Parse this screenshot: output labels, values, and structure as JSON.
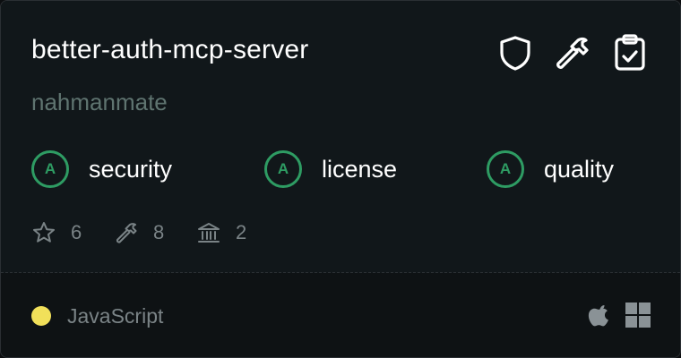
{
  "repo": {
    "name": "better-auth-mcp-server",
    "owner": "nahmanmate"
  },
  "header_icons": [
    "shield-icon",
    "hammer-icon",
    "clipboard-check-icon"
  ],
  "grades": [
    {
      "letter": "A",
      "label": "security"
    },
    {
      "letter": "A",
      "label": "license"
    },
    {
      "letter": "A",
      "label": "quality"
    }
  ],
  "stats": {
    "stars": "6",
    "tools": "8",
    "resources": "2"
  },
  "language": {
    "name": "JavaScript",
    "color": "#f1e05a"
  },
  "platforms": [
    "apple-icon",
    "windows-icon"
  ],
  "colors": {
    "grade_green": "#2e9c63",
    "title": "#ffffff",
    "muted": "#5f7470"
  }
}
